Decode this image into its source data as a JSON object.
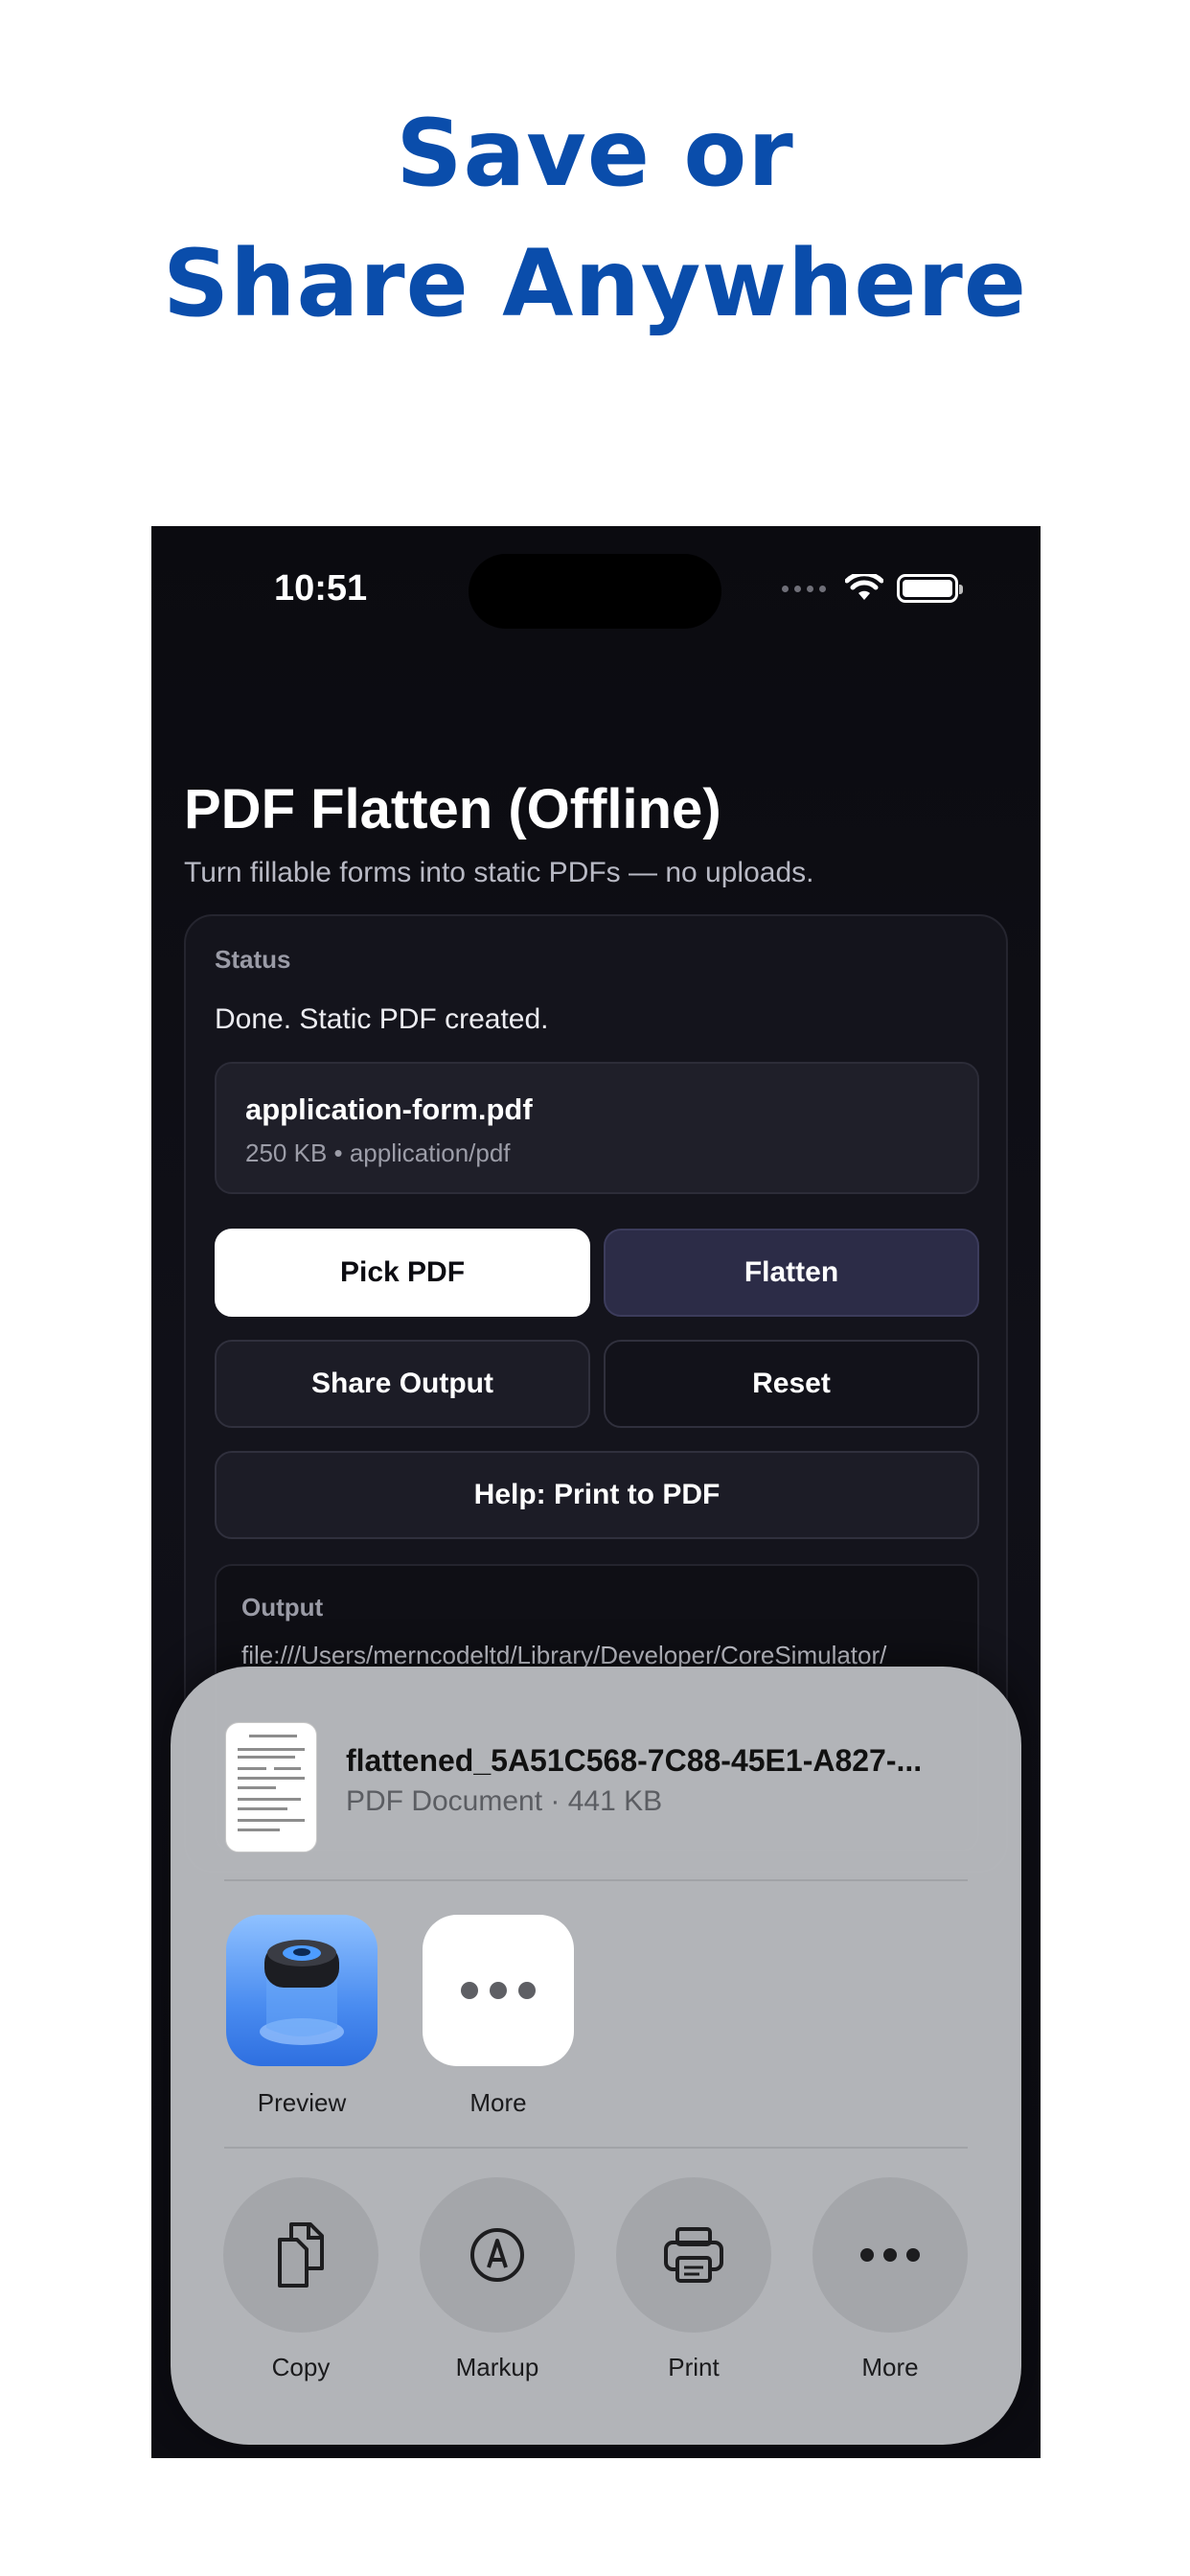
{
  "headline": {
    "line1": "Save or",
    "line2": "Share Anywhere"
  },
  "status_bar": {
    "time": "10:51"
  },
  "app": {
    "title": "PDF Flatten (Offline)",
    "subtitle": "Turn fillable forms into static PDFs — no uploads."
  },
  "status_card": {
    "label": "Status",
    "message": "Done. Static PDF created.",
    "file": {
      "name": "application-form.pdf",
      "meta": "250 KB • application/pdf"
    }
  },
  "buttons": {
    "pick_pdf": "Pick PDF",
    "flatten": "Flatten",
    "share_output": "Share Output",
    "reset": "Reset",
    "help": "Help: Print to PDF"
  },
  "output": {
    "label": "Output",
    "path": "file:///Users/merncodeltd/Library/Developer/CoreSimulator/"
  },
  "share_sheet": {
    "file_name": "flattened_5A51C568-7C88-45E1-A827-...",
    "file_meta": "PDF Document · 441 KB",
    "apps": [
      {
        "label": "Preview",
        "icon": "preview-app-icon"
      },
      {
        "label": "More",
        "icon": "more-apps-icon"
      }
    ],
    "actions": [
      {
        "label": "Copy",
        "icon": "copy-icon"
      },
      {
        "label": "Markup",
        "icon": "markup-icon"
      },
      {
        "label": "Print",
        "icon": "print-icon"
      },
      {
        "label": "More",
        "icon": "more-icon"
      }
    ]
  },
  "colors": {
    "headline": "#0a4dab",
    "app_background": "#0b0b10",
    "primary_button": "#ffffff",
    "accent_button": "#2c2c47",
    "share_sheet": "#b8babe"
  }
}
